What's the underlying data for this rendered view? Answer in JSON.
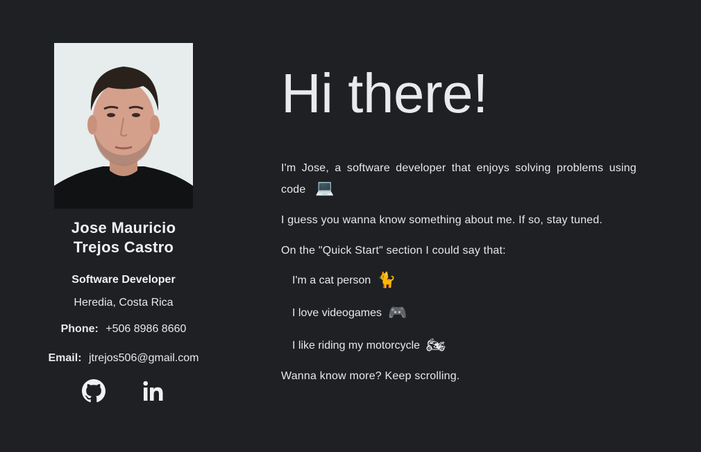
{
  "profile": {
    "name_line1": "Jose Mauricio",
    "name_line2": "Trejos Castro",
    "role": "Software Developer",
    "location": "Heredia, Costa Rica",
    "phone_label": "Phone:",
    "phone_value": "+506 8986 8660",
    "email_label": "Email:",
    "email_value": "jtrejos506@gmail.com",
    "socials": [
      {
        "icon": "github-icon"
      },
      {
        "icon": "linkedin-icon"
      }
    ]
  },
  "main": {
    "title": "Hi there!",
    "intro_text": "I'm Jose, a software developer that enjoys solving problems using code",
    "intro_emoji": "💻",
    "paragraph2": "I guess you wanna know something about me. If so, stay tuned.",
    "paragraph3": "On the \"Quick Start\" section I could say that:",
    "facts": [
      {
        "text": "I'm a cat person",
        "emoji": "🐈"
      },
      {
        "text": "I love videogames",
        "emoji": "🎮"
      },
      {
        "text": "I like riding my motorcycle",
        "emoji": "🏍"
      }
    ],
    "outro": "Wanna know more? Keep scrolling."
  },
  "colors": {
    "background": "#1f2023",
    "text": "#e8e8ea"
  }
}
